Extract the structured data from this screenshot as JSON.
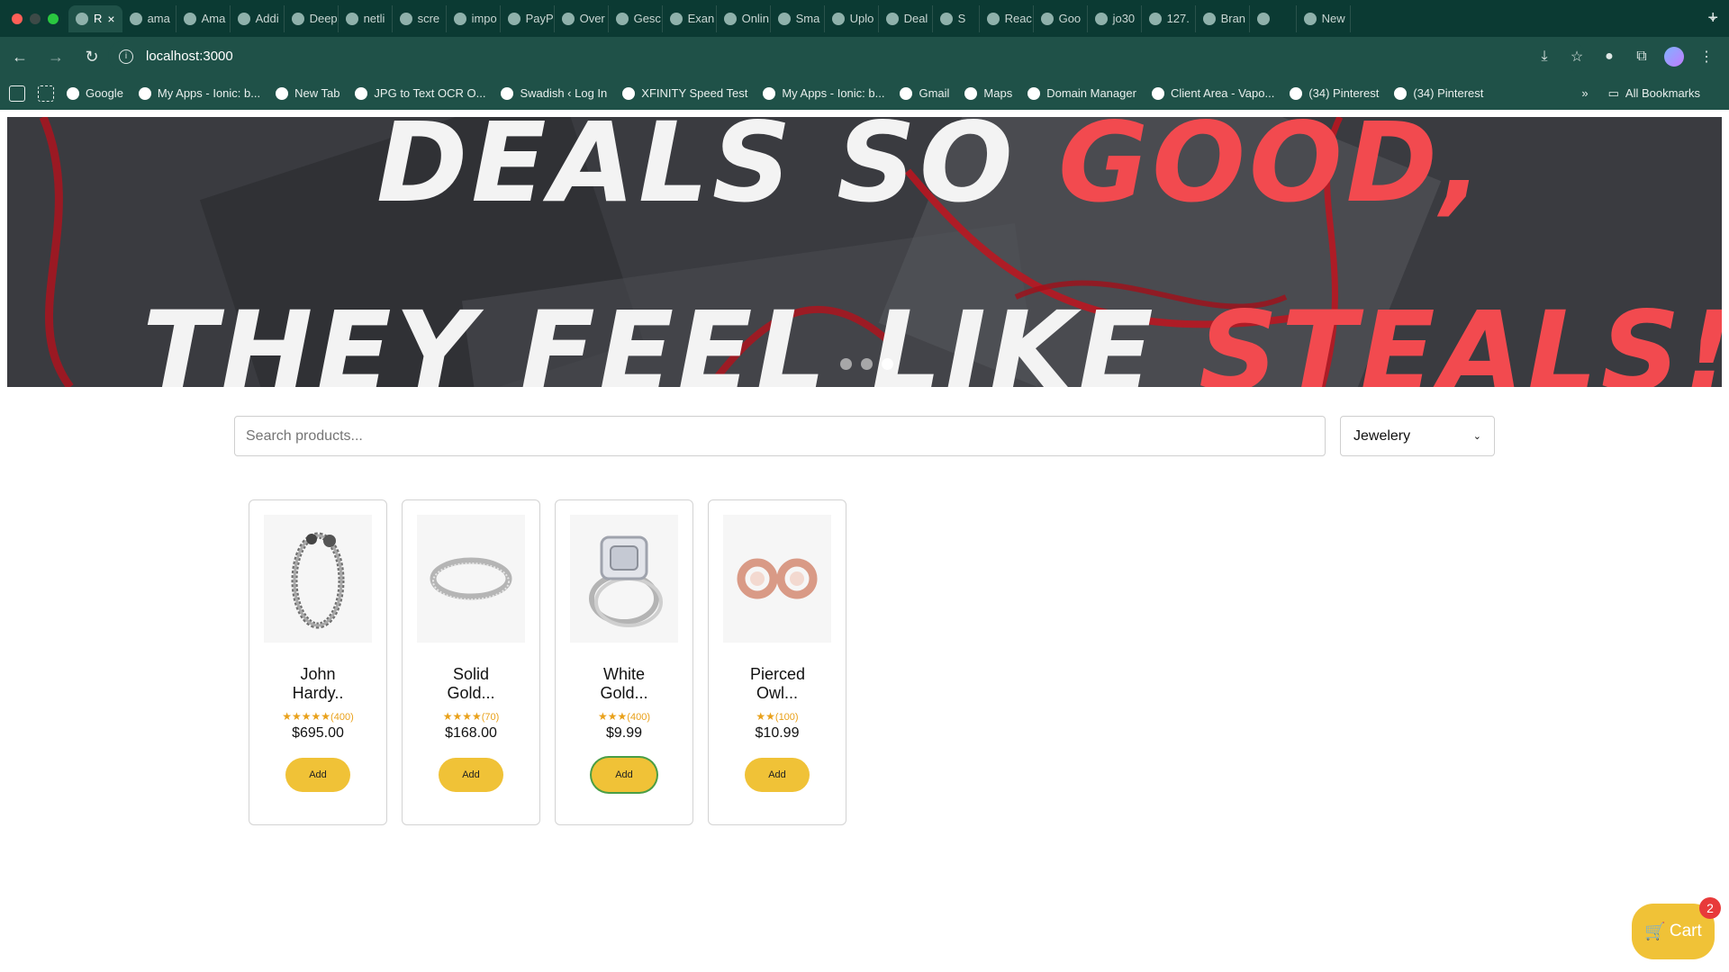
{
  "browser": {
    "tabs": [
      {
        "title": "R",
        "icon": "react-icon",
        "active": true
      },
      {
        "title": "ama",
        "icon": "google-icon"
      },
      {
        "title": "Ama",
        "icon": "amazon-icon"
      },
      {
        "title": "Addi",
        "icon": "web-icon"
      },
      {
        "title": "Deep",
        "icon": "deepl-icon"
      },
      {
        "title": "netli",
        "icon": "netlify-icon"
      },
      {
        "title": "scre",
        "icon": "web-icon"
      },
      {
        "title": "impo",
        "icon": "deepl-icon"
      },
      {
        "title": "PayP",
        "icon": "paypal-icon"
      },
      {
        "title": "Over",
        "icon": "paypal-icon"
      },
      {
        "title": "Gesc",
        "icon": "paypal-icon"
      },
      {
        "title": "Exan",
        "icon": "web-icon"
      },
      {
        "title": "Onlin",
        "icon": "pipedream-icon"
      },
      {
        "title": "Sma",
        "icon": "is-icon"
      },
      {
        "title": "Uplo",
        "icon": "copilot-icon"
      },
      {
        "title": "Deal",
        "icon": "copilot-icon"
      },
      {
        "title": "S",
        "icon": "shop-icon"
      },
      {
        "title": "Reac",
        "icon": "react-icon"
      },
      {
        "title": "Goo",
        "icon": "google-icon"
      },
      {
        "title": "jo30",
        "icon": "web-icon"
      },
      {
        "title": "127.",
        "icon": "vscode-icon"
      },
      {
        "title": "Bran",
        "icon": "github-icon"
      },
      {
        "title": "",
        "icon": "blank-icon"
      },
      {
        "title": "New",
        "icon": "chrome-icon"
      }
    ],
    "new_tab_label": "+",
    "url": "localhost:3000",
    "bookmarks": [
      {
        "label": "Google",
        "icon": "google-icon"
      },
      {
        "label": "My Apps - Ionic: b...",
        "icon": "ionic-icon"
      },
      {
        "label": "New Tab",
        "icon": "chrome-icon"
      },
      {
        "label": "JPG to Text OCR O...",
        "icon": "ocr-icon"
      },
      {
        "label": "Swadish ‹ Log In",
        "icon": "swadish-icon"
      },
      {
        "label": "XFINITY Speed Test",
        "icon": "x-icon"
      },
      {
        "label": "My Apps - Ionic: b...",
        "icon": "ionic-icon"
      },
      {
        "label": "Gmail",
        "icon": "google-icon"
      },
      {
        "label": "Maps",
        "icon": "maps-icon"
      },
      {
        "label": "Domain Manager",
        "icon": "domain-icon"
      },
      {
        "label": "Client Area - Vapo...",
        "icon": "vapor-icon"
      },
      {
        "label": "(34) Pinterest",
        "icon": "pinterest-icon"
      },
      {
        "label": "(34) Pinterest",
        "icon": "pinterest-icon"
      }
    ],
    "all_bookmarks_label": "All Bookmarks"
  },
  "hero": {
    "line1_white": "DEALS SO ",
    "line1_red": "GOOD,",
    "line2_white": "THEY FEEL LIKE ",
    "line2_red": "STEALS!",
    "active_slide": 3,
    "slide_count": 3
  },
  "filters": {
    "search_placeholder": "Search products...",
    "category": "Jewelery"
  },
  "products": [
    {
      "name": "John Hardy..",
      "stars": "★★★★★",
      "count": "(400)",
      "price": "$695.00",
      "button": "Add",
      "image": "bracelet"
    },
    {
      "name": "Solid Gold...",
      "stars": "★★★★",
      "count": "(70)",
      "price": "$168.00",
      "button": "Add",
      "image": "ring"
    },
    {
      "name": "White Gold...",
      "stars": "★★★",
      "count": "(400)",
      "price": "$9.99",
      "button": "Add",
      "image": "diamond-ring"
    },
    {
      "name": "Pierced Owl...",
      "stars": "★★",
      "count": "(100)",
      "price": "$10.99",
      "button": "Add",
      "image": "rose-gold-earrings"
    }
  ],
  "cart": {
    "icon": "🛒",
    "label": "Cart",
    "count": "2"
  },
  "colors": {
    "accent": "#f0c237",
    "badge": "#e83a3a",
    "chrome": "#1f5148"
  }
}
